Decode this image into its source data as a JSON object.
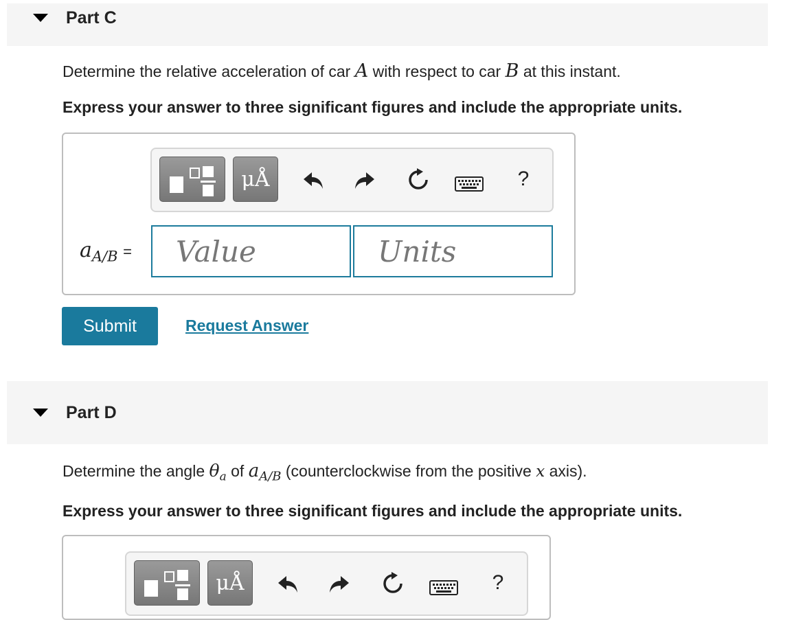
{
  "partC": {
    "title": "Part C",
    "question": {
      "pre": "Determine the relative acceleration of car ",
      "var1": "A",
      "mid": " with respect to car ",
      "var2": "B",
      "post": " at this instant."
    },
    "instruction": "Express your answer to three significant figures and include the appropriate units.",
    "toolbar": {
      "templates_icon": "fraction-template-icon",
      "units_label": "μÅ",
      "undo_icon": "undo-icon",
      "redo_icon": "redo-icon",
      "reset_icon": "reset-icon",
      "keyboard_icon": "keyboard-icon",
      "help_label": "?"
    },
    "variable": {
      "symbol": "a",
      "subscript": "A/B",
      "equals": "="
    },
    "value_placeholder": "Value",
    "units_placeholder": "Units",
    "submit_label": "Submit",
    "request_label": "Request Answer"
  },
  "partD": {
    "title": "Part D",
    "question": {
      "pre": "Determine the angle ",
      "theta": "θ",
      "theta_sub": "a",
      "of": " of ",
      "a": "a",
      "a_sub": "A/B",
      "post1": " (counterclockwise from the positive ",
      "x": "x",
      "post2": " axis)."
    },
    "instruction": "Express your answer to three significant figures and include the appropriate units.",
    "toolbar": {
      "units_label": "μÅ",
      "help_label": "?"
    }
  },
  "colors": {
    "accent": "#1a7a9d",
    "header_bg": "#f5f5f5",
    "field_border": "#1c7b9c"
  }
}
